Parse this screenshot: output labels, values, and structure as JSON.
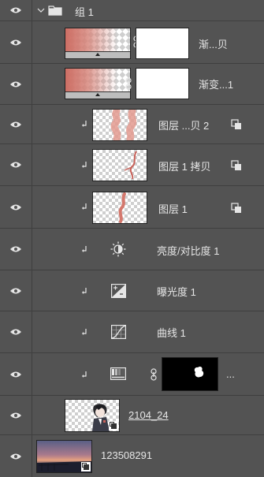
{
  "colors": {
    "panel_bg": "#535353",
    "row_divider": "#3f3f3f",
    "text": "#e6e6e6",
    "mask_black": "#000000",
    "accent_red": "#c8625a"
  },
  "group": {
    "toggle_icon": "chevron-down-icon",
    "folder_icon": "folder-icon",
    "name": "组 1"
  },
  "layers": [
    {
      "name": "渐...贝",
      "kind": "gradient-fill-with-mask",
      "link_icon": "chain-link-icon"
    },
    {
      "name": "渐变...1",
      "kind": "gradient-fill-with-mask",
      "link_icon": "chain-link-icon"
    },
    {
      "name": "图层 ...贝 2",
      "kind": "pixel-layer-clipped",
      "badge_icon": "smart-object-icon"
    },
    {
      "name": "图层 1 拷贝",
      "kind": "pixel-layer-clipped",
      "badge_icon": "smart-object-icon"
    },
    {
      "name": "图层 1",
      "kind": "pixel-layer-clipped",
      "badge_icon": "smart-object-icon"
    },
    {
      "name": "亮度/对比度 1",
      "kind": "adjustment",
      "icon": "brightness-contrast-icon"
    },
    {
      "name": "曝光度 1",
      "kind": "adjustment",
      "icon": "exposure-icon"
    },
    {
      "name": "曲线 1",
      "kind": "adjustment",
      "icon": "curves-icon"
    },
    {
      "name": "...",
      "kind": "adjustment-with-mask",
      "icon": "gradient-map-icon",
      "link_icon": "chain-link-icon"
    },
    {
      "name": "2104_24",
      "kind": "smart-object"
    },
    {
      "name": "123508291",
      "kind": "smart-object"
    }
  ]
}
